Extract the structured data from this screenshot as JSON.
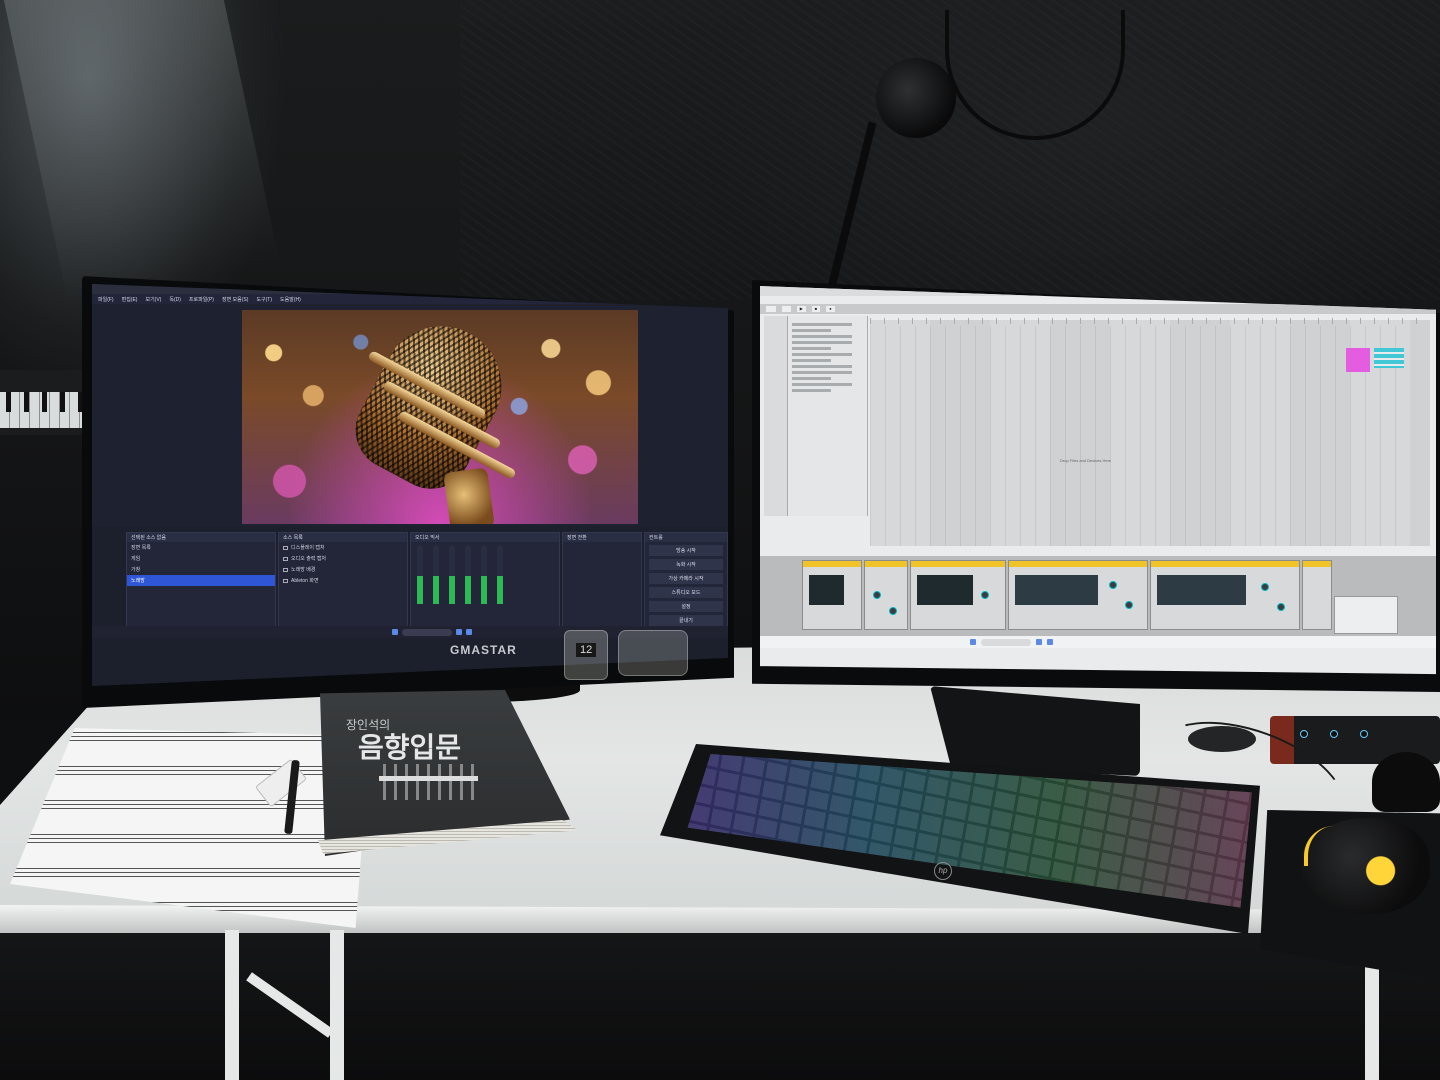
{
  "scene": {
    "left_monitor": {
      "brand": "GMASTAR",
      "app": "OBS",
      "menu": [
        "파일(F)",
        "편집(E)",
        "보기(V)",
        "독(D)",
        "프로파일(P)",
        "장면 모음(S)",
        "도구(T)",
        "도움말(H)"
      ],
      "docks": {
        "scenes_title": "선택된 소스 없음",
        "scenes": [
          "장면 목록",
          "게임",
          "가창",
          "노래방"
        ],
        "selected_scene_index": 3,
        "sources_title": "소스 목록",
        "sources": [
          "디스플레이 캡처",
          "오디오 출력 캡처",
          "노래방 배경",
          "Ableton 화면"
        ],
        "mixer_title": "오디오 믹서",
        "transitions_title": "장면 전환",
        "controls_title": "컨트롤",
        "controls": [
          "방송 시작",
          "녹화 시작",
          "가상 카메라 시작",
          "스튜디오 모드",
          "설정",
          "끝내기"
        ]
      }
    },
    "right_monitor": {
      "app": "DAW",
      "drop_hint": "Drop Files and Devices Here"
    },
    "desk": {
      "book": {
        "subtitle": "장인석의",
        "title": "음향입문"
      },
      "bottle_label": "12",
      "keyboard_brand": "hp"
    },
    "colors": {
      "obs_selected": "#2f56d6",
      "daw_clip": "#e45de0",
      "daw_accent": "#41c7d6",
      "device_header": "#f0c428",
      "mouse_glow": "#ffd53a"
    }
  }
}
